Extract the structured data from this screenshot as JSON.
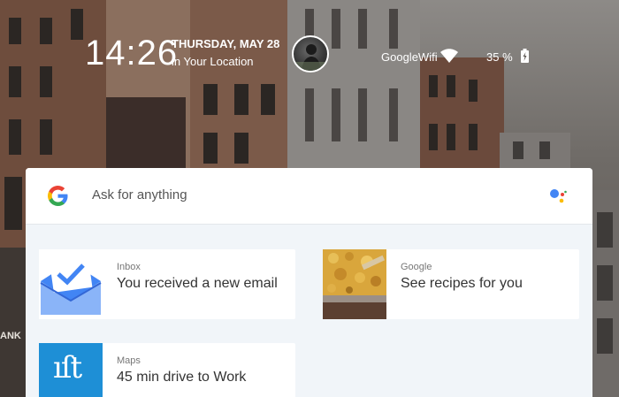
{
  "status_bar": {
    "time": "14:26",
    "date": "THURSDAY, MAY 28",
    "location": "in Your Location",
    "wifi_name": "GoogleWifi",
    "battery": "35 %"
  },
  "search": {
    "placeholder": "Ask for anything",
    "logo_icon": "google-g-icon",
    "assistant_icon": "google-assistant-icon"
  },
  "cards": [
    {
      "app": "Inbox",
      "message": "You received a new email",
      "icon": "inbox-icon"
    },
    {
      "app": "Google",
      "message": "See recipes for you",
      "icon": "food-photo"
    },
    {
      "app": "Maps",
      "message": "45 min drive to Work",
      "icon": "ift-logo"
    }
  ],
  "ift_logo_text": "ıſt",
  "colors": {
    "google_blue": "#4285F4",
    "google_red": "#EA4335",
    "google_yellow": "#FBBC05",
    "google_green": "#34A853",
    "inbox_blue": "#4285F4",
    "ift_blue": "#1e8fd6"
  }
}
